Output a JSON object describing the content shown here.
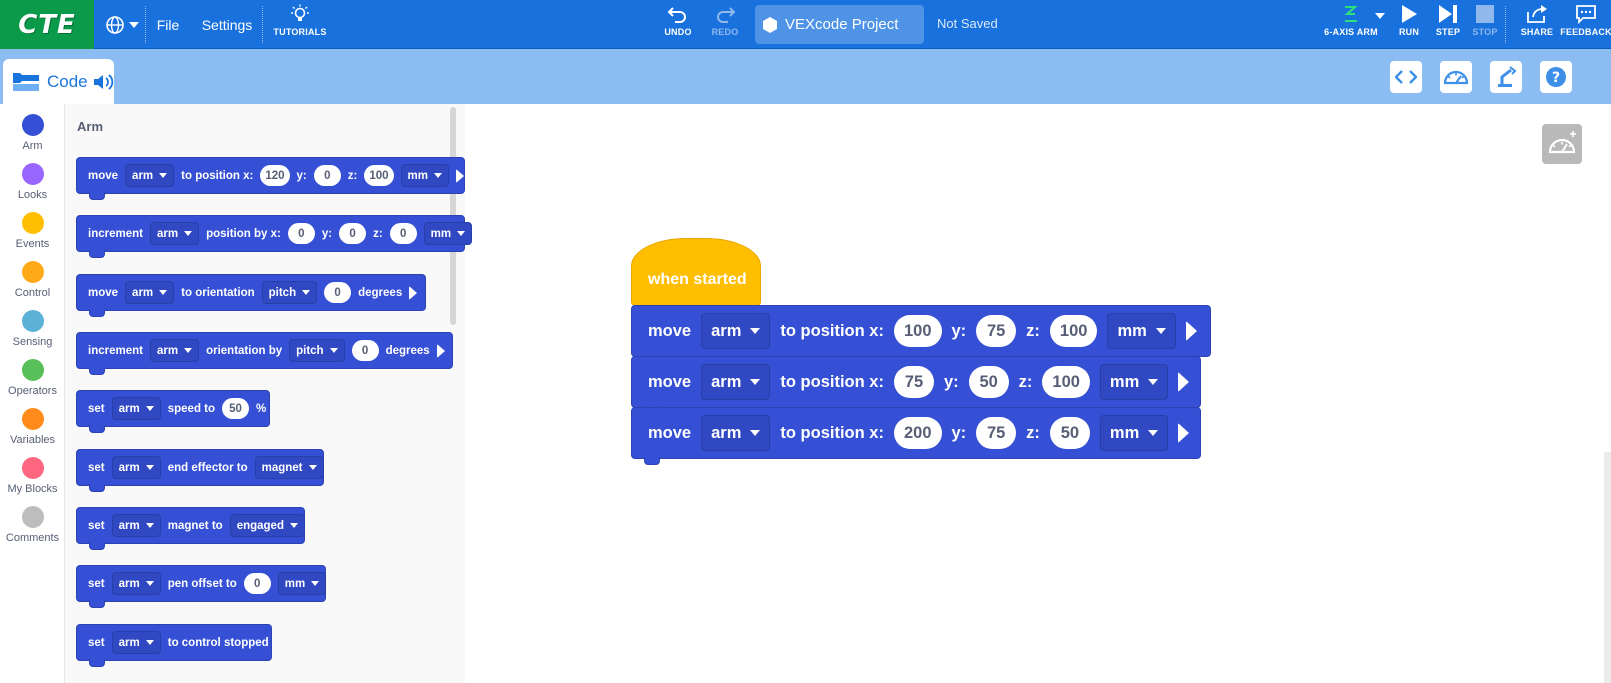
{
  "topbar": {
    "logo": "CTE",
    "file": "File",
    "settings": "Settings",
    "tutorials": "TUTORIALS",
    "undo": "UNDO",
    "redo": "REDO",
    "project_name": "VEXcode Project",
    "save_status": "Not Saved",
    "device": "6-AXIS ARM",
    "run": "RUN",
    "step": "STEP",
    "stop": "STOP",
    "share": "SHARE",
    "feedback": "FEEDBACK"
  },
  "code_tab": {
    "label": "Code"
  },
  "categories": [
    {
      "label": "Arm",
      "color": "#3550d4"
    },
    {
      "label": "Looks",
      "color": "#9966ff"
    },
    {
      "label": "Events",
      "color": "#ffbf00"
    },
    {
      "label": "Control",
      "color": "#ffab19"
    },
    {
      "label": "Sensing",
      "color": "#5cb1d6"
    },
    {
      "label": "Operators",
      "color": "#59c059"
    },
    {
      "label": "Variables",
      "color": "#ff8c1a"
    },
    {
      "label": "My Blocks",
      "color": "#ff6680"
    },
    {
      "label": "Comments",
      "color": "#bdbdbd"
    }
  ],
  "flyout": {
    "title": "Arm",
    "b1": {
      "w1": "move",
      "dd1": "arm",
      "w2": "to position x:",
      "x": "120",
      "w3": "y:",
      "y": "0",
      "w4": "z:",
      "z": "100",
      "unit": "mm"
    },
    "b2": {
      "w1": "increment",
      "dd1": "arm",
      "w2": "position by x:",
      "x": "0",
      "w3": "y:",
      "y": "0",
      "w4": "z:",
      "z": "0",
      "unit": "mm"
    },
    "b3": {
      "w1": "move",
      "dd1": "arm",
      "w2": "to orientation",
      "dd2": "pitch",
      "v": "0",
      "w3": "degrees"
    },
    "b4": {
      "w1": "increment",
      "dd1": "arm",
      "w2": "orientation by",
      "dd2": "pitch",
      "v": "0",
      "w3": "degrees"
    },
    "b5": {
      "w1": "set",
      "dd1": "arm",
      "w2": "speed to",
      "v": "50",
      "w3": "%"
    },
    "b6": {
      "w1": "set",
      "dd1": "arm",
      "w2": "end effector to",
      "dd2": "magnet"
    },
    "b7": {
      "w1": "set",
      "dd1": "arm",
      "w2": "magnet to",
      "dd2": "engaged"
    },
    "b8": {
      "w1": "set",
      "dd1": "arm",
      "w2": "pen offset to",
      "v": "0",
      "dd2": "mm"
    },
    "b9": {
      "w1": "set",
      "dd1": "arm",
      "w2": "to control stopped"
    }
  },
  "workspace": {
    "hat": "when started",
    "s1": {
      "w1": "move",
      "dd1": "arm",
      "w2": "to position x:",
      "x": "100",
      "w3": "y:",
      "y": "75",
      "w4": "z:",
      "z": "100",
      "unit": "mm"
    },
    "s2": {
      "w1": "move",
      "dd1": "arm",
      "w2": "to position x:",
      "x": "75",
      "w3": "y:",
      "y": "50",
      "w4": "z:",
      "z": "100",
      "unit": "mm"
    },
    "s3": {
      "w1": "move",
      "dd1": "arm",
      "w2": "to position x:",
      "x": "200",
      "w3": "y:",
      "y": "75",
      "w4": "z:",
      "z": "50",
      "unit": "mm"
    }
  }
}
